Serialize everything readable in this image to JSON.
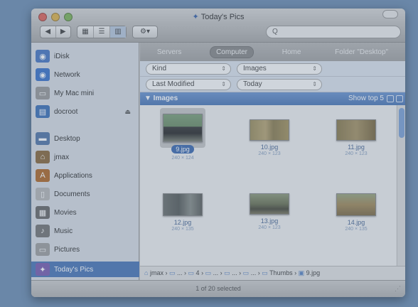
{
  "window": {
    "title": "Today's Pics"
  },
  "toolbar": {
    "back_label": "◀",
    "forward_label": "▶",
    "view_icon": "▦",
    "view_list": "☰",
    "view_column": "▥",
    "action_label": "⚙▾",
    "search_placeholder": "Q"
  },
  "sidebar": {
    "items": [
      {
        "label": "iDisk",
        "icon": "globe-icon",
        "color": "#4a78c2",
        "glyph": "◉"
      },
      {
        "label": "Network",
        "icon": "network-icon",
        "color": "#3c74c9",
        "glyph": "◉"
      },
      {
        "label": "My Mac mini",
        "icon": "computer-icon",
        "color": "#9a9a9a",
        "glyph": "▭"
      },
      {
        "label": "docroot",
        "icon": "server-icon",
        "color": "#3f72b8",
        "glyph": "▤"
      },
      {
        "label": "Desktop",
        "icon": "desktop-icon",
        "color": "#5578a8",
        "glyph": "▬"
      },
      {
        "label": "jmax",
        "icon": "home-icon",
        "color": "#8b6a3d",
        "glyph": "⌂"
      },
      {
        "label": "Applications",
        "icon": "applications-icon",
        "color": "#b06a2a",
        "glyph": "A"
      },
      {
        "label": "Documents",
        "icon": "documents-icon",
        "color": "#b8b8b8",
        "glyph": "▯"
      },
      {
        "label": "Movies",
        "icon": "movies-icon",
        "color": "#6a6a6a",
        "glyph": "▦"
      },
      {
        "label": "Music",
        "icon": "music-icon",
        "color": "#777777",
        "glyph": "♪"
      },
      {
        "label": "Pictures",
        "icon": "pictures-icon",
        "color": "#a0a0a0",
        "glyph": "▭"
      },
      {
        "label": "Today's Pics",
        "icon": "smart-folder-icon",
        "color": "#7b5fb0",
        "glyph": "✦"
      }
    ]
  },
  "scope": {
    "servers": "Servers",
    "computer": "Computer",
    "home": "Home",
    "folder": "Folder \"Desktop\""
  },
  "criteria": [
    {
      "field": "Kind",
      "value": "Images"
    },
    {
      "field": "Last Modified",
      "value": "Today"
    }
  ],
  "section": {
    "title": "▼ Images",
    "show_top": "Show top 5"
  },
  "files": [
    {
      "name": "9.jpg",
      "dims": "240 × 124",
      "selected": true
    },
    {
      "name": "10.jpg",
      "dims": "240 × 123",
      "selected": false
    },
    {
      "name": "11.jpg",
      "dims": "240 × 123",
      "selected": false
    },
    {
      "name": "12.jpg",
      "dims": "240 × 135",
      "selected": false
    },
    {
      "name": "13.jpg",
      "dims": "240 × 123",
      "selected": false
    },
    {
      "name": "14.jpg",
      "dims": "240 × 135",
      "selected": false
    }
  ],
  "path_bar": {
    "p0": "jmax",
    "p1": "...",
    "p2": "4",
    "p3": "...",
    "p4": "...",
    "p5": "...",
    "p6": "Thumbs",
    "p7": "9.jpg"
  },
  "status": {
    "text": "1 of 20 selected"
  }
}
